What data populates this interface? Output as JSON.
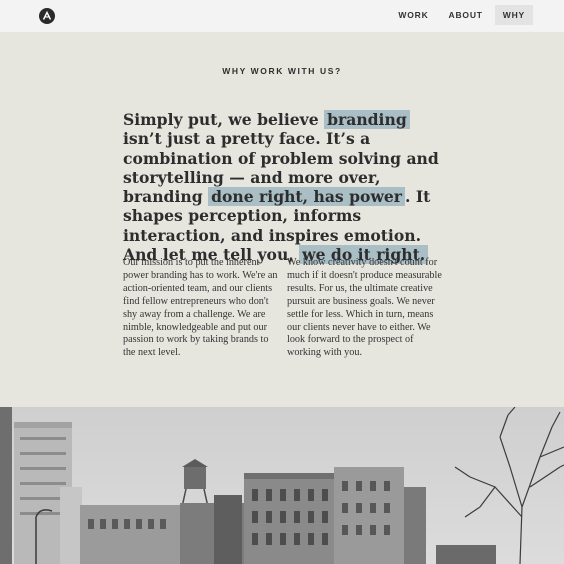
{
  "nav": {
    "items": [
      {
        "label": "WORK",
        "active": false
      },
      {
        "label": "ABOUT",
        "active": false
      },
      {
        "label": "WHY",
        "active": true
      }
    ]
  },
  "section": {
    "kicker": "WHY WORK WITH US?",
    "headline": {
      "t1": "Simply put, we believe ",
      "h1": "branding",
      "t2": " isn’t just a pretty face. It’s a combination of problem solving and storytelling — and more over, branding ",
      "h2": "done right, has power",
      "t3": ". It shapes perception, informs interaction, and inspires emotion. And let me tell you, ",
      "h3": "we do it right."
    },
    "col_left": "Our mission is to put the inherent power branding has to work. We're an action-oriented team, and our clients find fellow entrepreneurs who don't shy away from a challenge. We are nimble, knowledgeable and put our passion to work by taking brands to the next level.",
    "col_right": "We know creativity doesn't count for much if it doesn't produce measurable results. For us, the ultimate creative pursuit are business goals. We never settle for less. Which in turn, means our clients never have to either. We look forward to the prospect of working with you."
  },
  "colors": {
    "highlight": "#a9bec5",
    "background": "#e6e6df",
    "topbar": "#f3f3f3"
  }
}
